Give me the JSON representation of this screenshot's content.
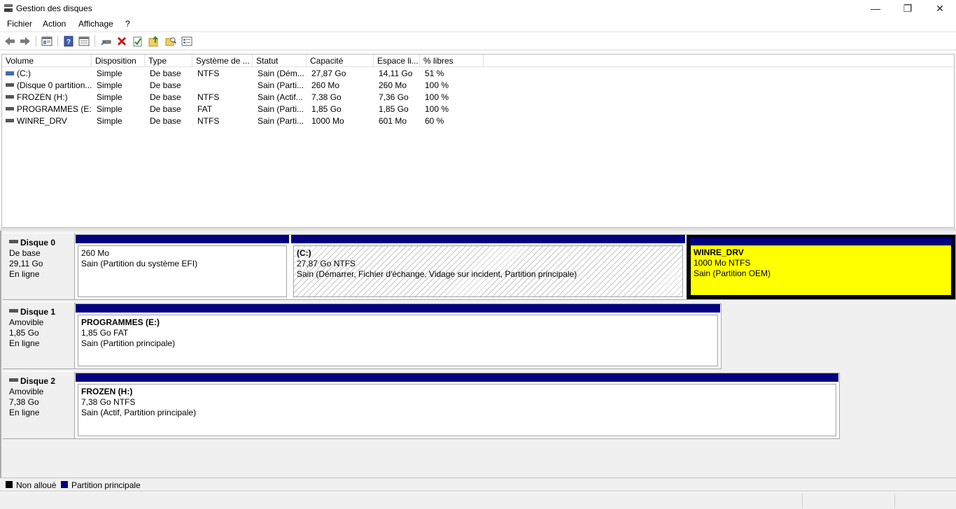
{
  "window": {
    "title": "Gestion des disques",
    "minimize_glyph": "—",
    "maximize_glyph": "❐",
    "close_glyph": "✕"
  },
  "menu": [
    "Fichier",
    "Action",
    "Affichage",
    "?"
  ],
  "toolbar": {
    "icons": [
      "back-arrow-icon",
      "forward-arrow-icon",
      "console-tree-icon",
      "help-icon",
      "console-view-icon",
      "connect-drive-icon",
      "delete-icon",
      "checklist-icon",
      "folder-up-icon",
      "folder-search-icon",
      "properties-icon"
    ]
  },
  "volume_list": {
    "columns": [
      "Volume",
      "Disposition",
      "Type",
      "Système de ...",
      "Statut",
      "Capacité",
      "Espace li...",
      "% libres"
    ],
    "rows": [
      [
        "(C:)",
        "Simple",
        "De base",
        "NTFS",
        "Sain (Dém...",
        "27,87 Go",
        "14,11 Go",
        "51 %"
      ],
      [
        "(Disque 0 partition...",
        "Simple",
        "De base",
        "",
        "Sain (Parti...",
        "260 Mo",
        "260 Mo",
        "100 %"
      ],
      [
        "FROZEN (H:)",
        "Simple",
        "De base",
        "NTFS",
        "Sain (Actif...",
        "7,38 Go",
        "7,36 Go",
        "100 %"
      ],
      [
        "PROGRAMMES (E:)",
        "Simple",
        "De base",
        "FAT",
        "Sain (Parti...",
        "1,85 Go",
        "1,85 Go",
        "100 %"
      ],
      [
        "WINRE_DRV",
        "Simple",
        "De base",
        "NTFS",
        "Sain (Parti...",
        "1000 Mo",
        "601 Mo",
        "60 %"
      ]
    ]
  },
  "disks": [
    {
      "name": "Disque 0",
      "type": "De base",
      "size": "29,11 Go",
      "status": "En ligne",
      "partitions": [
        {
          "title": "",
          "line1": "260 Mo",
          "line2": "Sain (Partition du système EFI)"
        },
        {
          "title": "(C:)",
          "line1": "27,87 Go NTFS",
          "line2": "Sain (Démarrer, Fichier d'échange, Vidage sur incident, Partition principale)"
        },
        {
          "title": "WINRE_DRV",
          "line1": "1000 Mo NTFS",
          "line2": "Sain (Partition OEM)"
        }
      ]
    },
    {
      "name": "Disque 1",
      "type": "Amovible",
      "size": "1,85 Go",
      "status": "En ligne",
      "partitions": [
        {
          "title": "PROGRAMMES  (E:)",
          "line1": "1,85 Go FAT",
          "line2": "Sain (Partition principale)"
        }
      ]
    },
    {
      "name": "Disque 2",
      "type": "Amovible",
      "size": "7,38 Go",
      "status": "En ligne",
      "partitions": [
        {
          "title": "FROZEN  (H:)",
          "line1": "7,38 Go NTFS",
          "line2": "Sain (Actif, Partition principale)"
        }
      ]
    }
  ],
  "legend": [
    {
      "label": "Non alloué",
      "color": "#000000"
    },
    {
      "label": "Partition principale",
      "color": "#000080"
    }
  ],
  "colors": {
    "partition_bar": "#000080",
    "selected_fill": "#ffff00"
  }
}
